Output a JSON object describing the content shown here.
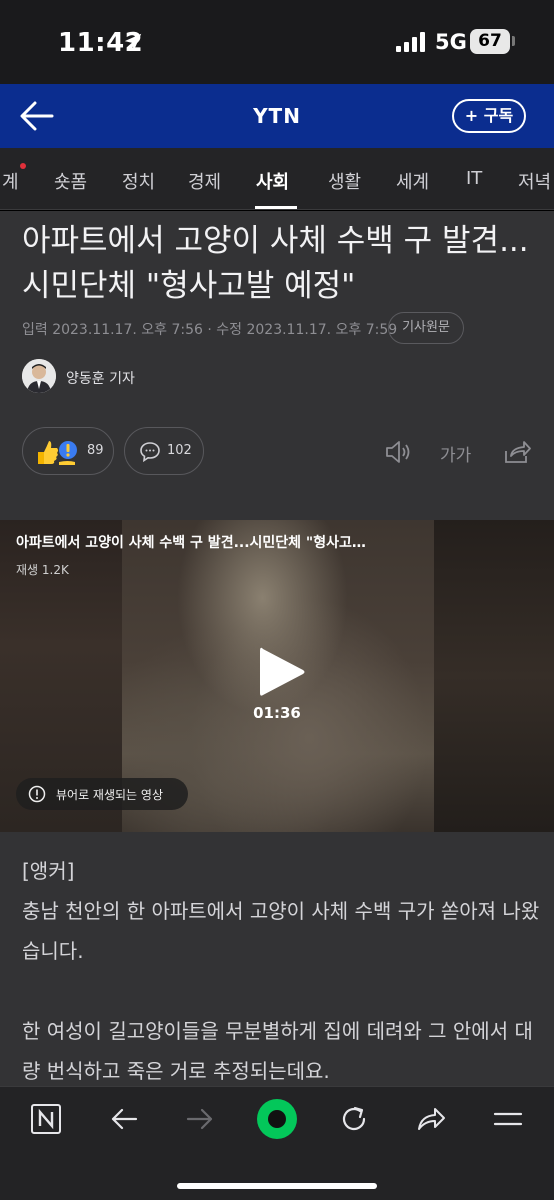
{
  "status_bar": {
    "time": "11:42",
    "network": "5G",
    "battery": "67"
  },
  "header": {
    "title": "YTN",
    "subscribe_label": "+ 구독"
  },
  "categories": [
    {
      "label": "계",
      "active": false
    },
    {
      "label": "숏폼",
      "active": false
    },
    {
      "label": "정치",
      "active": false
    },
    {
      "label": "경제",
      "active": false
    },
    {
      "label": "사회",
      "active": true
    },
    {
      "label": "생활",
      "active": false
    },
    {
      "label": "세계",
      "active": false
    },
    {
      "label": "IT",
      "active": false
    },
    {
      "label": "저녁",
      "active": false
    }
  ],
  "article": {
    "title": "아파트에서 고양이 사체 수백 구 발견...시민단체 \"형사고발 예정\"",
    "meta": "입력 2023.11.17. 오후 7:56 · 수정 2023.11.17. 오후 7:59",
    "original_label": "기사원문",
    "reporter": "양동훈 기자",
    "like_count": "89",
    "comment_count": "102",
    "font_label": "가가"
  },
  "video": {
    "title": "아파트에서 고양이 사체 수백 구 발견...시민단체 \"형사고…",
    "views": "재생 1.2K",
    "duration": "01:36",
    "viewer_notice": "뷰어로 재생되는 영상"
  },
  "body": {
    "anchor": "[앵커]",
    "para1": "충남 천안의 한 아파트에서 고양이 사체 수백 구가 쏟아져 나왔습니다.",
    "para2": "한 여성이 길고양이들을 무분별하게 집에 데려와 그 안에서 대량 번식하고 죽은 거로 추정되는데요."
  },
  "colors": {
    "header_bg": "#0b2d8f",
    "article_bg": "#333335",
    "accent_green": "#03c75a"
  },
  "icons": [
    "location-arrow-icon",
    "signal-icon",
    "back-arrow-icon",
    "like-emoji-icon",
    "comment-icon",
    "speaker-icon",
    "share-icon",
    "play-icon",
    "info-icon",
    "naver-n-icon",
    "refresh-icon",
    "menu-icon"
  ]
}
